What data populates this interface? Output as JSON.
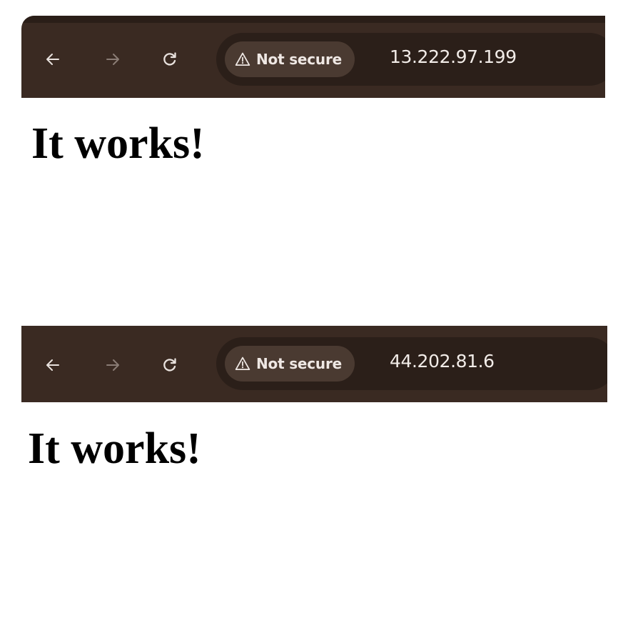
{
  "panels": [
    {
      "security_label": "Not secure",
      "url": "13.222.97.199",
      "heading": "It works!"
    },
    {
      "security_label": "Not secure",
      "url": "44.202.81.6",
      "heading": "It works!"
    }
  ],
  "icons": {
    "back": "back-arrow-icon",
    "forward": "forward-arrow-icon",
    "reload": "reload-icon",
    "warning": "warning-triangle-icon"
  },
  "colors": {
    "toolbar": "#3a2a22",
    "omnibox": "#2b1f19",
    "security_chip": "#4a3a31",
    "text_light": "#f2ece8",
    "page_background": "#ffffff"
  }
}
